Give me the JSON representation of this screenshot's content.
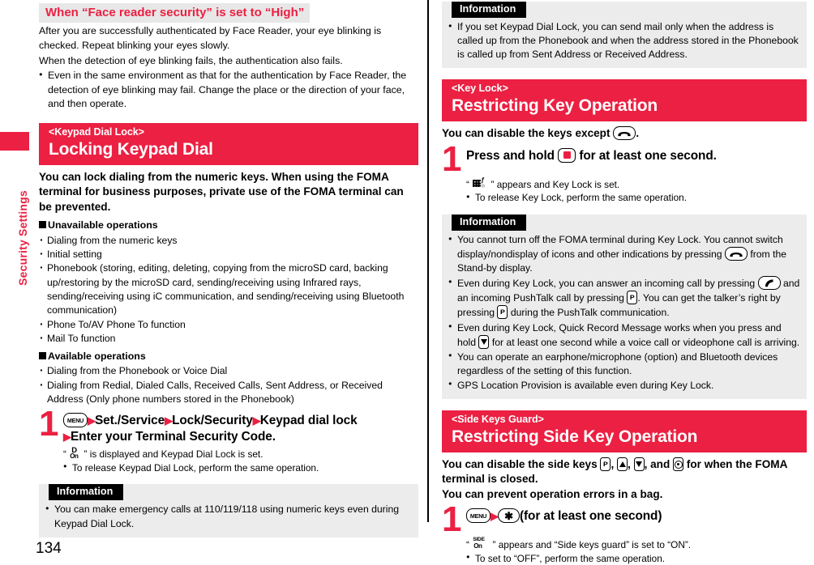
{
  "page": {
    "number": "134",
    "side_tab_label": "Security Settings",
    "accent_color": "#EB2042"
  },
  "left_column": {
    "face_reader": {
      "heading": "When “Face reader security” is set to “High”",
      "paragraphs": [
        "After you are successfully authenticated by Face Reader, your eye blinking is checked. Repeat blinking your eyes slowly.",
        "When the detection of eye blinking fails, the authentication also fails."
      ],
      "bullets": [
        "Even in the same environment as that for the authentication by Face Reader, the detection of eye blinking may fail. Change the place or the direction of your face, and then operate."
      ]
    },
    "keypad_dial_lock": {
      "banner_sub": "<Keypad Dial Lock>",
      "banner_main": "Locking Keypad Dial",
      "lead": "You can lock dialing from the numeric keys. When using the FOMA terminal for business purposes, private use of the FOMA terminal can be prevented.",
      "unavailable_heading": "Unavailable operations",
      "unavailable_items": [
        "Dialing from the numeric keys",
        "Initial setting",
        "Phonebook (storing, editing, deleting, copying from the microSD card, backing up/restoring by the microSD card, sending/receiving using Infrared rays, sending/receiving using iC communication, and sending/receiving using Bluetooth communication)",
        "Phone To/AV Phone To function",
        "Mail To function"
      ],
      "available_heading": "Available operations",
      "available_items": [
        "Dialing from the Phonebook or Voice Dial",
        "Dialing from Redial, Dialed Calls, Received Calls, Sent Address, or Received Address (Only phone numbers stored in the Phonebook)"
      ],
      "step": {
        "number": "1",
        "key_label": "MENU",
        "parts": [
          "Set./Service",
          "Lock/Security",
          "Keypad dial lock",
          "Enter your Terminal Security Code."
        ],
        "note_icon_top": "D",
        "note_icon_bottom": "On",
        "note_text_after": "” is displayed and Keypad Dial Lock is set.",
        "note_quote_open": "“",
        "bullets": [
          "To release Keypad Dial Lock, perform the same operation."
        ]
      },
      "information": {
        "tag": "Information",
        "bullets": [
          "You can make emergency calls at 110/119/118 using numeric keys even during Keypad Dial Lock."
        ]
      }
    }
  },
  "right_column": {
    "information_top": {
      "tag": "Information",
      "bullets": [
        "If you set Keypad Dial Lock, you can send mail only when the address is called up from the Phonebook and when the address stored in the Phonebook is called up from Sent Address or Received Address."
      ]
    },
    "key_lock": {
      "banner_sub": "<Key Lock>",
      "banner_main": "Restricting Key Operation",
      "lead_before": "You can disable the keys except",
      "lead_after": ".",
      "step": {
        "number": "1",
        "text_before": "Press and hold",
        "text_after": "for at least one second.",
        "note_quote_open": "“",
        "note_text_after": "” appears and Key Lock is set.",
        "bullets": [
          "To release Key Lock, perform the same operation."
        ]
      },
      "information": {
        "tag": "Information",
        "bullets": [
          {
            "segments": [
              {
                "type": "text",
                "value": "You cannot turn off the FOMA terminal during Key Lock. You cannot switch display/nondisplay of icons and other indications by pressing "
              },
              {
                "type": "key",
                "value": "end-call-key"
              },
              {
                "type": "text",
                "value": " from the Stand-by display."
              }
            ]
          },
          {
            "segments": [
              {
                "type": "text",
                "value": "Even during Key Lock, you can answer an incoming call by pressing "
              },
              {
                "type": "key",
                "value": "send-call-key"
              },
              {
                "type": "text",
                "value": " and an incoming PushTalk call by pressing "
              },
              {
                "type": "key",
                "value": "pushtalk-key"
              },
              {
                "type": "text",
                "value": ". You can get the talker’s right by pressing "
              },
              {
                "type": "key",
                "value": "pushtalk-key"
              },
              {
                "type": "text",
                "value": " during the PushTalk communication."
              }
            ]
          },
          {
            "segments": [
              {
                "type": "text",
                "value": "Even during Key Lock, Quick Record Message works when you press and hold "
              },
              {
                "type": "key",
                "value": "down-key"
              },
              {
                "type": "text",
                "value": " for at least one second while a voice call or videophone call is arriving."
              }
            ]
          },
          {
            "segments": [
              {
                "type": "text",
                "value": "You can operate an earphone/microphone (option) and Bluetooth devices regardless of the setting of this function."
              }
            ]
          },
          {
            "segments": [
              {
                "type": "text",
                "value": "GPS Location Provision is available even during Key Lock."
              }
            ]
          }
        ]
      }
    },
    "side_keys_guard": {
      "banner_sub": "<Side Keys Guard>",
      "banner_main": "Restricting Side Key Operation",
      "lead_part1": "You can disable the side keys",
      "lead_part2": "for when the FOMA terminal is closed.",
      "lead_part3": "You can prevent operation errors in a bag.",
      "step": {
        "number": "1",
        "key_label": "MENU",
        "text_after": "(for at least one second)",
        "note_icon_top": "SIDE",
        "note_icon_bottom": "On",
        "note_quote_open": "“",
        "note_text_after": "” appears and “Side keys guard” is set to “ON”.",
        "bullets": [
          "To set to “OFF”, perform the same operation."
        ]
      }
    }
  }
}
